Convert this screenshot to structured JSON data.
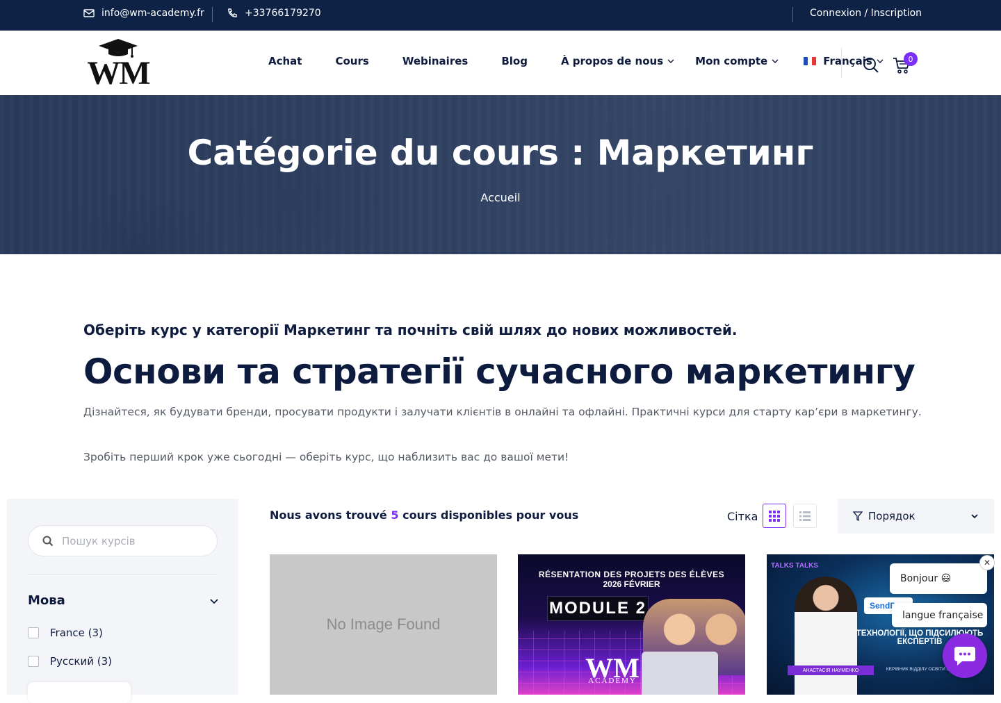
{
  "topbar": {
    "email": "info@wm-academy.fr",
    "phone": "+33766179270",
    "auth_link": "Connexion / Inscription"
  },
  "header": {
    "logo_text": "WM",
    "nav": [
      {
        "label": "Achat"
      },
      {
        "label": "Cours"
      },
      {
        "label": "Webinaires"
      },
      {
        "label": "Blog"
      },
      {
        "label": "À propos de nous"
      },
      {
        "label": "Mon compte"
      },
      {
        "label": "Français"
      }
    ],
    "cart_count": "0"
  },
  "hero": {
    "title": "Catégorie du cours : Маркетинг",
    "breadcrumb": "Accueil"
  },
  "intro": {
    "subtitle": "Оберіть курс у категорії Маркетинг та почніть свій шлях до нових можливостей.",
    "title": "Основи та стратегії сучасного маркетингу",
    "paragraph1": "Дізнайтеся, як будувати бренди, просувати продукти і залучати клієнтів в онлайні та офлайні. Практичні курси для старту кар’єри в маркетингу.",
    "paragraph2": "Зробіть перший крок уже сьогодні — оберіть курс, що наблизить вас до вашої мети!"
  },
  "sidebar": {
    "search_placeholder": "Пошук курсів",
    "filter_title": "Мова",
    "options": [
      {
        "label": "France (3)"
      },
      {
        "label": "Русский (3)"
      }
    ]
  },
  "results": {
    "found_prefix": "Nous avons trouvé",
    "found_count": "5",
    "found_suffix": "cours disponibles pour vous",
    "grid_label": "Сітка",
    "order_label": "Порядок"
  },
  "cards": [
    {
      "placeholder": "No Image Found"
    },
    {
      "line1": "RÉSENTATION DES PROJETS DES ÉLÈVES",
      "line2": "2026 FÉVRIER",
      "module": "MODULE 2",
      "brand": "WM",
      "brand_sub": "ACADEMY"
    },
    {
      "logo": "TALKS TALKS",
      "brand": "SendP",
      "headline": "ТЕХНОЛОГІЇ, ЩО ПІДСИЛЮЮТЬ ЕКСПЕРТІВ",
      "speaker": "АНАСТАСІЯ НАУМЕНКО",
      "role": "КЕРІВНИК ВІДДІЛУ ОСВІТИ SENDPULSE"
    }
  ],
  "chat": {
    "greeting": "Bonjour 😃",
    "language": "langue française",
    "close": "✕"
  },
  "colors": {
    "topbar": "#0d2244",
    "accent": "#7b2ff7",
    "heading": "#0d1b3e",
    "chat": "#8a2be2"
  }
}
